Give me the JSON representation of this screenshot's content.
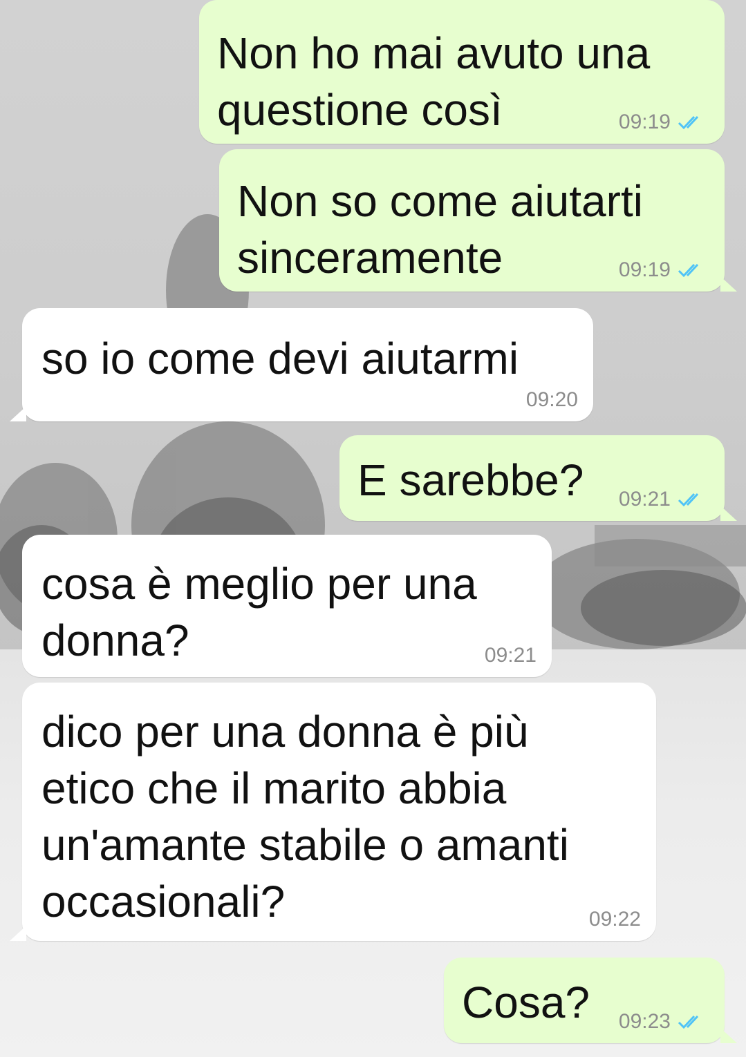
{
  "colors": {
    "outgoing_bubble": "#e7fecf",
    "incoming_bubble": "#ffffff",
    "read_ticks": "#4fc3f7",
    "timestamp": "#8c8c8c"
  },
  "icons": {
    "read_receipt": "double-check-icon"
  },
  "messages": [
    {
      "direction": "outgoing",
      "text": "Non ho mai avuto una\nquestione così",
      "time": "09:19"
    },
    {
      "direction": "outgoing",
      "text": "Non so come aiutarti\nsinceramente",
      "time": "09:19"
    },
    {
      "direction": "incoming",
      "text": "so io come devi aiutarmi",
      "time": "09:20"
    },
    {
      "direction": "outgoing",
      "text": "E sarebbe?",
      "time": "09:21"
    },
    {
      "direction": "incoming",
      "text": "cosa è meglio per una\ndonna?",
      "time": "09:21"
    },
    {
      "direction": "incoming",
      "text": "dico per una donna è più\netico che il marito abbia\nun'amante stabile o amanti\noccasionali?",
      "time": "09:22"
    },
    {
      "direction": "outgoing",
      "text": "Cosa?",
      "time": "09:23"
    }
  ]
}
